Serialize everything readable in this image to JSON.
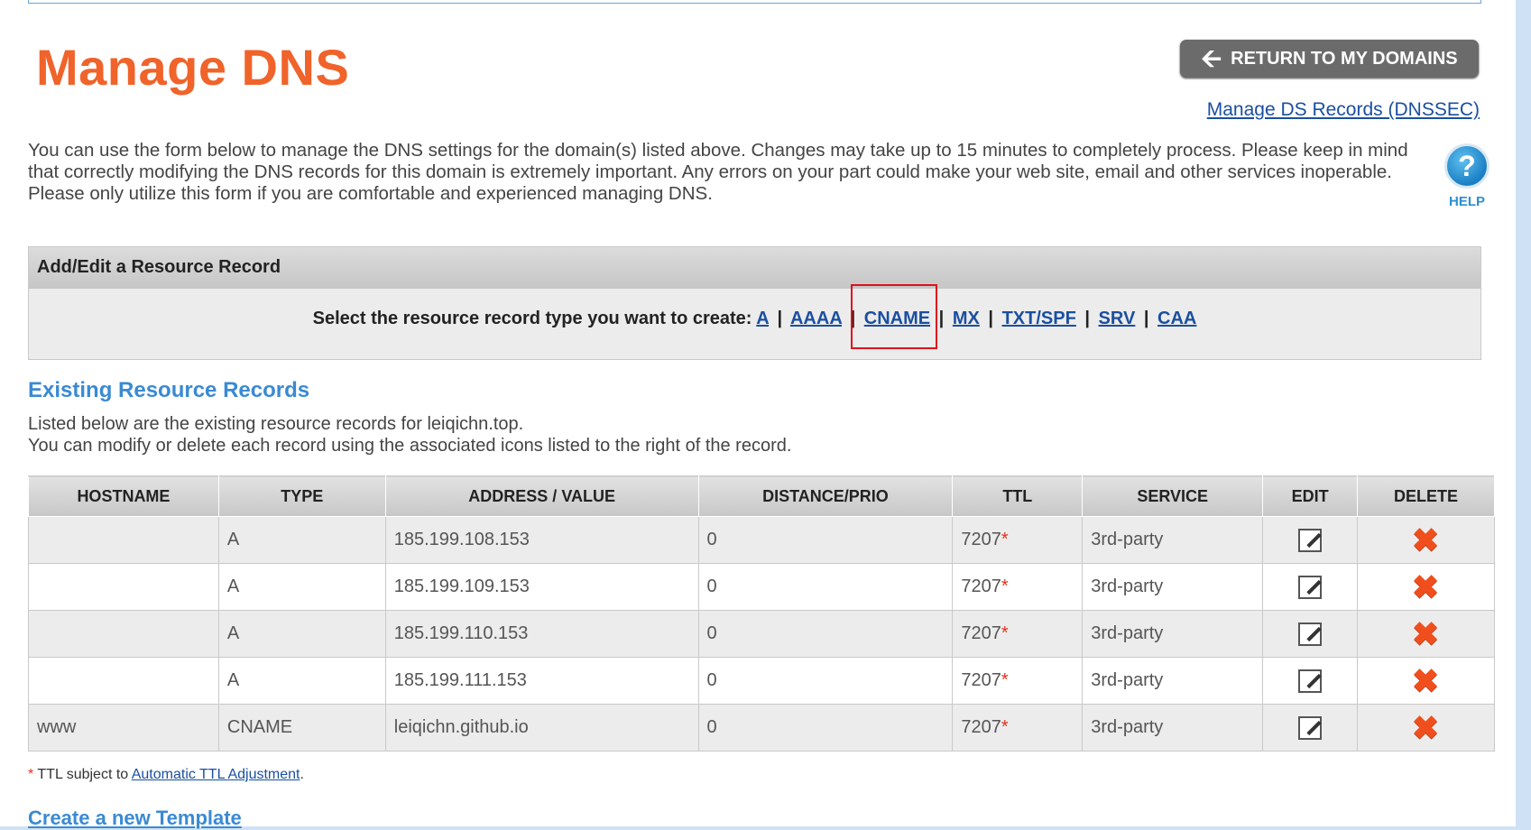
{
  "page": {
    "title": "Manage DNS"
  },
  "header": {
    "return_button": "RETURN TO MY DOMAINS",
    "ds_link": "Manage DS Records (DNSSEC)"
  },
  "intro": "You can use the form below to manage the DNS settings for the domain(s) listed above. Changes may take up to 15 minutes to completely process. Please keep in mind that correctly modifying the DNS records for this domain is extremely important. Any errors on your part could make your web site, email and other services inoperable. Please only utilize this form if you are comfortable and experienced managing DNS.",
  "help": {
    "glyph": "?",
    "label": "HELP"
  },
  "add_edit": {
    "heading": "Add/Edit a Resource Record",
    "prompt": "Select the resource record type you want to create:",
    "types": [
      "A",
      "AAAA",
      "CNAME",
      "MX",
      "TXT/SPF",
      "SRV",
      "CAA"
    ],
    "highlighted_type": "CNAME",
    "highlight_color": "#e0101a"
  },
  "existing": {
    "title": "Existing Resource Records",
    "line1": "Listed below are the existing resource records for leiqichn.top.",
    "line2": "You can modify or delete each record using the associated icons listed to the right of the record."
  },
  "table": {
    "columns": [
      "HOSTNAME",
      "TYPE",
      "ADDRESS / VALUE",
      "DISTANCE/PRIO",
      "TTL",
      "SERVICE",
      "EDIT",
      "DELETE"
    ],
    "rows": [
      {
        "hostname": "",
        "type": "A",
        "value": "185.199.108.153",
        "prio": "0",
        "ttl": "7207",
        "service": "3rd-party"
      },
      {
        "hostname": "",
        "type": "A",
        "value": "185.199.109.153",
        "prio": "0",
        "ttl": "7207",
        "service": "3rd-party"
      },
      {
        "hostname": "",
        "type": "A",
        "value": "185.199.110.153",
        "prio": "0",
        "ttl": "7207",
        "service": "3rd-party"
      },
      {
        "hostname": "",
        "type": "A",
        "value": "185.199.111.153",
        "prio": "0",
        "ttl": "7207",
        "service": "3rd-party"
      },
      {
        "hostname": "www",
        "type": "CNAME",
        "value": "leiqichn.github.io",
        "prio": "0",
        "ttl": "7207",
        "service": "3rd-party"
      }
    ],
    "ttl_marker": "*",
    "edit_icon": "edit-icon",
    "delete_icon": "delete-icon"
  },
  "footnote": {
    "marker": "*",
    "text": " TTL subject to ",
    "link": "Automatic TTL Adjustment",
    "end": "."
  },
  "template_title": "Create a new Template",
  "colors": {
    "title": "#f0632a",
    "link": "#1a4fa0",
    "section": "#3a8ad3",
    "delete": "#f04f1d"
  }
}
